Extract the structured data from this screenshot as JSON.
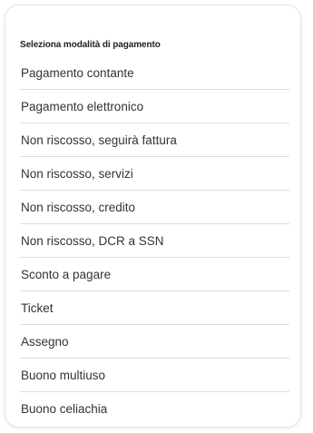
{
  "dialog": {
    "title": "Seleziona modalità di pagamento",
    "options": [
      {
        "label": "Pagamento contante"
      },
      {
        "label": "Pagamento elettronico"
      },
      {
        "label": "Non riscosso, seguirà fattura"
      },
      {
        "label": "Non riscosso, servizi"
      },
      {
        "label": "Non riscosso, credito"
      },
      {
        "label": "Non riscosso, DCR a SSN"
      },
      {
        "label": "Sconto a pagare"
      },
      {
        "label": "Ticket"
      },
      {
        "label": "Assegno"
      },
      {
        "label": "Buono multiuso"
      },
      {
        "label": "Buono celiachia"
      }
    ]
  }
}
